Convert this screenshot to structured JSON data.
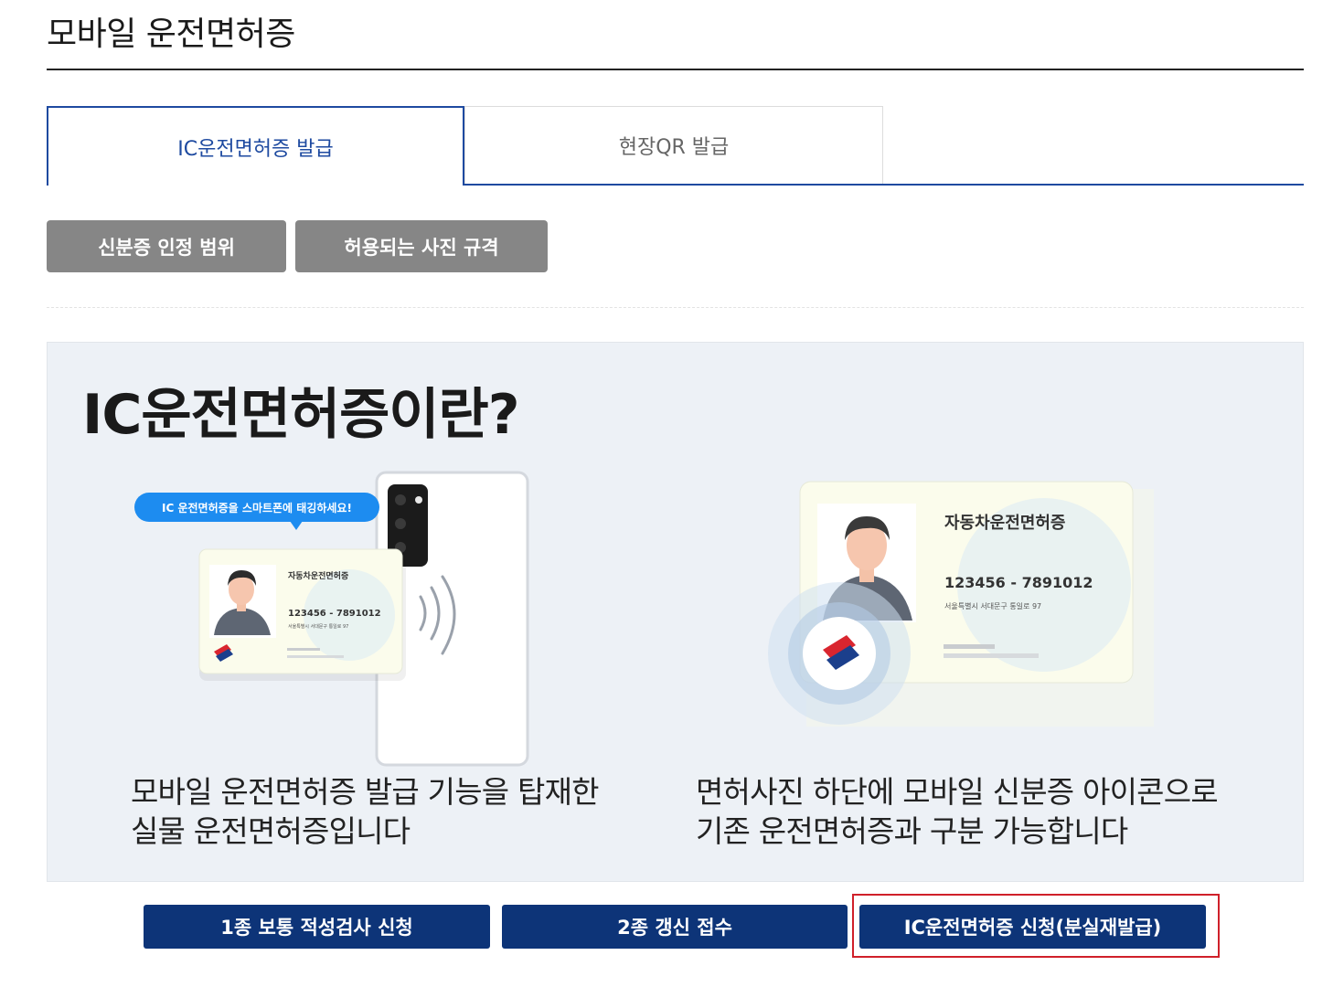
{
  "page": {
    "title": "모바일 운전면허증"
  },
  "tabs": [
    {
      "label": "IC운전면허증 발급",
      "active": true
    },
    {
      "label": "현장QR 발급",
      "active": false
    }
  ],
  "info_buttons": {
    "scope": "신분증 인정 범위",
    "photo_spec": "허용되는 사진 규격"
  },
  "intro": {
    "heading": "IC운전면허증이란?",
    "left_text_line1": "모바일 운전면허증 발급 기능을 탑재한",
    "left_text_line2": "실물 운전면허증입니다",
    "right_text_line1": "면허사진 하단에 모바일 신분증 아이콘으로",
    "right_text_line2": "기존 운전면허증과 구분 가능합니다",
    "tag_bubble": "IC 운전면허증을 스마트폰에 태깅하세요!",
    "card_small": {
      "title": "자동차운전면허증",
      "number": "123456 - 7891012",
      "address": "서울특별시 서대문구 통일로 97"
    },
    "card_large": {
      "title": "자동차운전면허증",
      "number": "123456 - 7891012",
      "address": "서울특별시 서대문구 통일로 97"
    }
  },
  "actions": {
    "aptitude_test": "1종 보통 적성검사 신청",
    "renewal": "2종 갱신 접수",
    "ic_apply": "IC운전면허증 신청(분실재발급)"
  },
  "colors": {
    "accent_blue": "#1e4aa0",
    "navy": "#0d3478",
    "gray_button": "#868686",
    "highlight_red": "#d0202a",
    "panel_bg": "#edf1f6"
  }
}
